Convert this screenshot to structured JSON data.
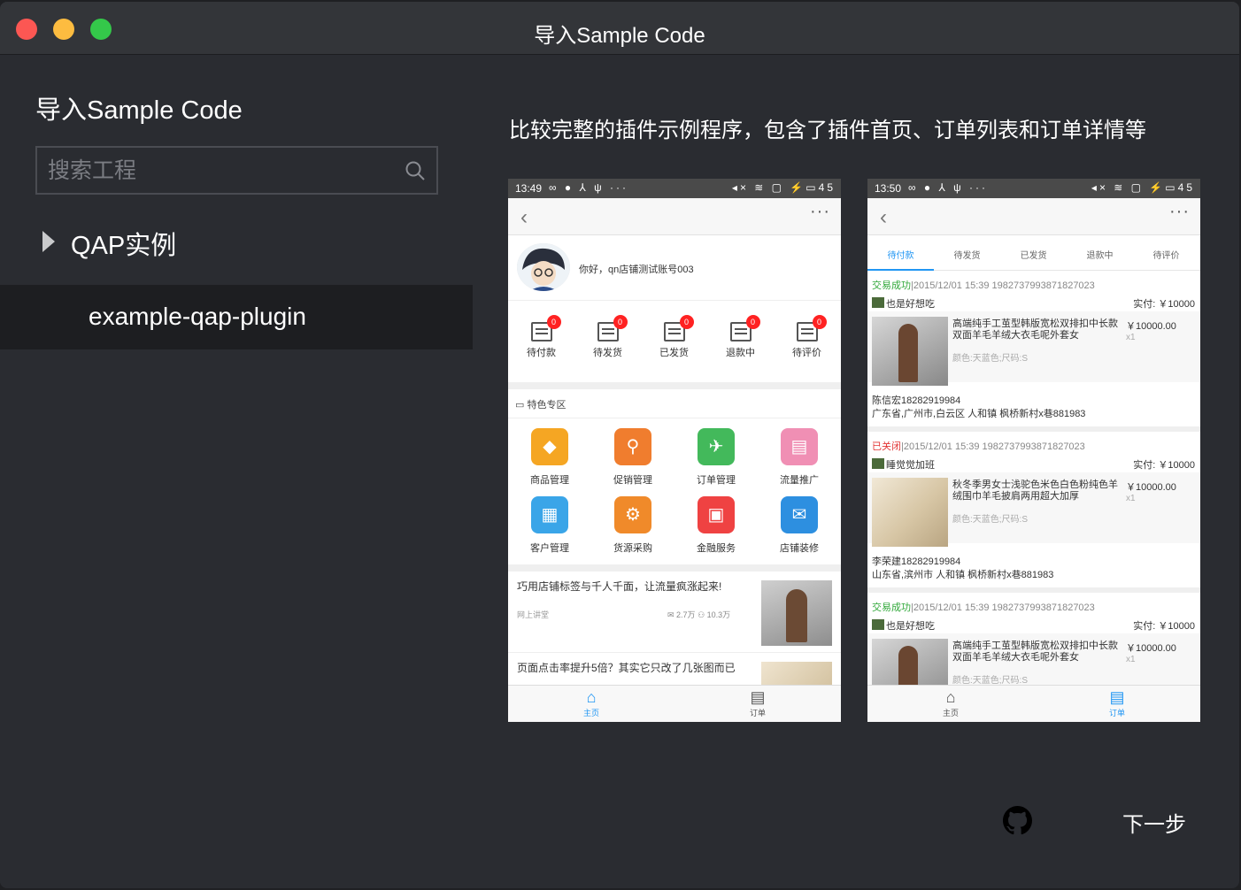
{
  "window": {
    "title": "导入Sample Code"
  },
  "sidebar": {
    "heading": "导入Sample Code",
    "search": {
      "placeholder": "搜索工程",
      "value": ""
    },
    "group": {
      "label": "QAP实例"
    },
    "items": [
      {
        "label": "example-qap-plugin",
        "selected": true
      }
    ]
  },
  "main": {
    "description": "比较完整的插件示例程序，包含了插件首页、订单列表和订单详情等",
    "next_label": "下一步"
  },
  "phone1": {
    "time": "13:49",
    "battery": "45",
    "greeting": "你好，qn店铺测试账号003",
    "order_states": [
      {
        "label": "待付款",
        "count": "0"
      },
      {
        "label": "待发货",
        "count": "0"
      },
      {
        "label": "已发货",
        "count": "0"
      },
      {
        "label": "退款中",
        "count": "0"
      },
      {
        "label": "待评价",
        "count": "0"
      }
    ],
    "featured_title": "特色专区",
    "features": [
      {
        "label": "商品管理",
        "color": "#f5a623",
        "glyph": "◆"
      },
      {
        "label": "促销管理",
        "color": "#f07d2e",
        "glyph": "⚲"
      },
      {
        "label": "订单管理",
        "color": "#43b95b",
        "glyph": "✈"
      },
      {
        "label": "流量推广",
        "color": "#f08fb4",
        "glyph": "▤"
      },
      {
        "label": "客户管理",
        "color": "#3aa5e8",
        "glyph": "▦"
      },
      {
        "label": "货源采购",
        "color": "#f08a2a",
        "glyph": "⚙"
      },
      {
        "label": "金融服务",
        "color": "#ef4242",
        "glyph": "▣"
      },
      {
        "label": "店铺装修",
        "color": "#2d8fe0",
        "glyph": "✉"
      }
    ],
    "articles": [
      {
        "title": "巧用店铺标签与千人千面，让流量疯涨起来!",
        "source": "网上讲堂",
        "mails": "2.7万",
        "reads": "10.3万"
      },
      {
        "title": "页面点击率提升5倍？其实它只改了几张图而已",
        "source": "",
        "mails": "",
        "reads": ""
      }
    ],
    "tabs": [
      {
        "label": "主页",
        "active": true
      },
      {
        "label": "订单",
        "active": false
      }
    ]
  },
  "phone2": {
    "time": "13:50",
    "battery": "45",
    "tabs": [
      "待付款",
      "待发货",
      "已发货",
      "退款中",
      "待评价"
    ],
    "orders": [
      {
        "status": "交易成功",
        "status_type": "ok",
        "meta": "|2015/12/01 15:39 1982737993871827023",
        "shop": "也是好想吃",
        "paid": "实付: ￥10000",
        "product": "高端纯手工茧型韩版宽松双排扣中长款双面羊毛羊绒大衣毛呢外套女",
        "price": "￥10000.00",
        "qty": "x1",
        "spec": "颜色:天蓝色;尺码:S",
        "buyer": "陈信宏18282919984",
        "address": "广东省,广州市,白云区 人和镇 枫桥新村x巷881983"
      },
      {
        "status": "已关闭",
        "status_type": "closed",
        "meta": "|2015/12/01 15:39 1982737993871827023",
        "shop": "睡觉觉加班",
        "paid": "实付: ￥10000",
        "product": "秋冬季男女士浅驼色米色白色粉纯色羊绒围巾羊毛披肩两用超大加厚",
        "price": "￥10000.00",
        "qty": "x1",
        "spec": "颜色:天蓝色;尺码:S",
        "buyer": "李荣建18282919984",
        "address": "山东省,滨州市 人和镇 枫桥新村x巷881983"
      },
      {
        "status": "交易成功",
        "status_type": "ok",
        "meta": "|2015/12/01 15:39 1982737993871827023",
        "shop": "也是好想吃",
        "paid": "实付: ￥10000",
        "product": "高端纯手工茧型韩版宽松双排扣中长款双面羊毛羊绒大衣毛呢外套女",
        "price": "￥10000.00",
        "qty": "x1",
        "spec": "颜色:天蓝色;尺码:S",
        "buyer": "",
        "address": ""
      }
    ],
    "bottom_tabs": [
      {
        "label": "主页",
        "active": false
      },
      {
        "label": "订单",
        "active": true
      }
    ]
  },
  "colors": {
    "accent": "#2196f3",
    "ok": "#31a83a",
    "closed": "#e23333",
    "background": "#2a2c31"
  },
  "icons": {
    "search": "search-icon",
    "github": "github-icon",
    "disclosure": "triangle-right-icon"
  }
}
